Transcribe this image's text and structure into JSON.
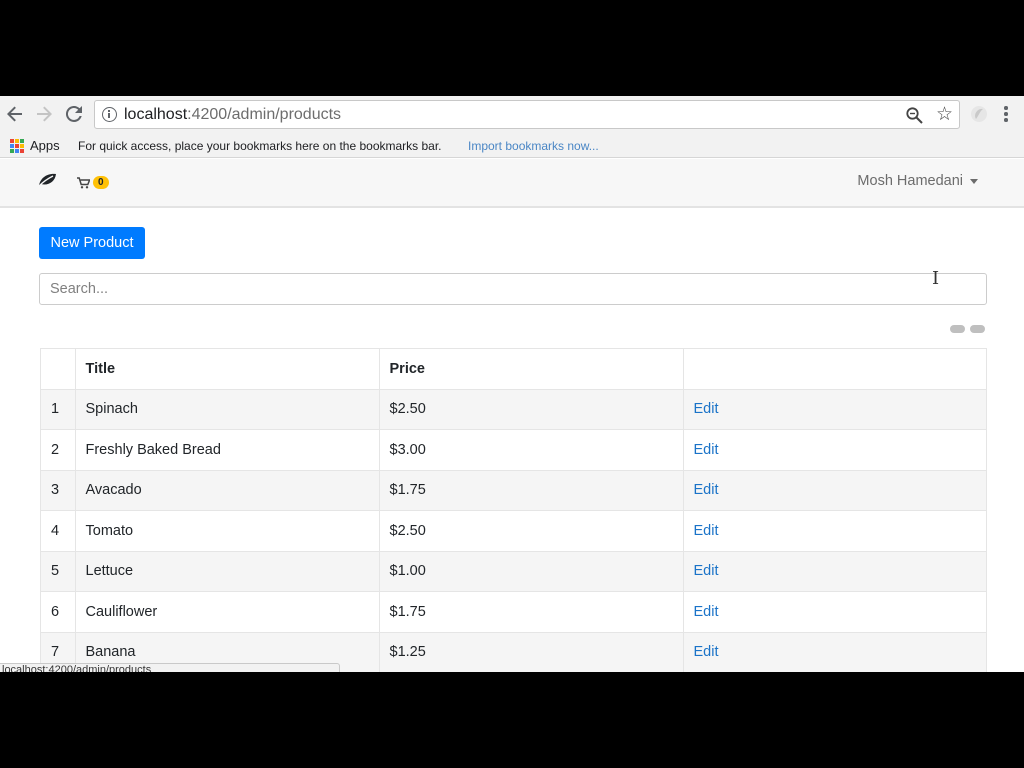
{
  "browser": {
    "url_host": "localhost",
    "url_path": ":4200/admin/products",
    "bookmarks_bar": {
      "apps_label": "Apps",
      "hint": "For quick access, place your bookmarks here on the bookmarks bar.",
      "import_link": "Import bookmarks now..."
    },
    "status_url": "localhost:4200/admin/products"
  },
  "navbar": {
    "brand_icon": "leaf-icon",
    "cart_icon": "shopping-cart-icon",
    "cart_count": "0",
    "user_name": "Mosh Hamedani"
  },
  "page": {
    "new_product_label": "New Product",
    "search_placeholder": "Search..."
  },
  "table": {
    "headers": [
      "",
      "Title",
      "Price",
      ""
    ],
    "rows": [
      {
        "index": "1",
        "title": "Spinach",
        "price": "$2.50",
        "action": "Edit"
      },
      {
        "index": "2",
        "title": "Freshly Baked Bread",
        "price": "$3.00",
        "action": "Edit"
      },
      {
        "index": "3",
        "title": "Avacado",
        "price": "$1.75",
        "action": "Edit"
      },
      {
        "index": "4",
        "title": "Tomato",
        "price": "$2.50",
        "action": "Edit"
      },
      {
        "index": "5",
        "title": "Lettuce",
        "price": "$1.00",
        "action": "Edit"
      },
      {
        "index": "6",
        "title": "Cauliflower",
        "price": "$1.75",
        "action": "Edit"
      },
      {
        "index": "7",
        "title": "Banana",
        "price": "$1.25",
        "action": "Edit"
      }
    ]
  },
  "colors": {
    "primary": "#007bff",
    "badge": "#ffc107",
    "link": "#1a73c8"
  }
}
